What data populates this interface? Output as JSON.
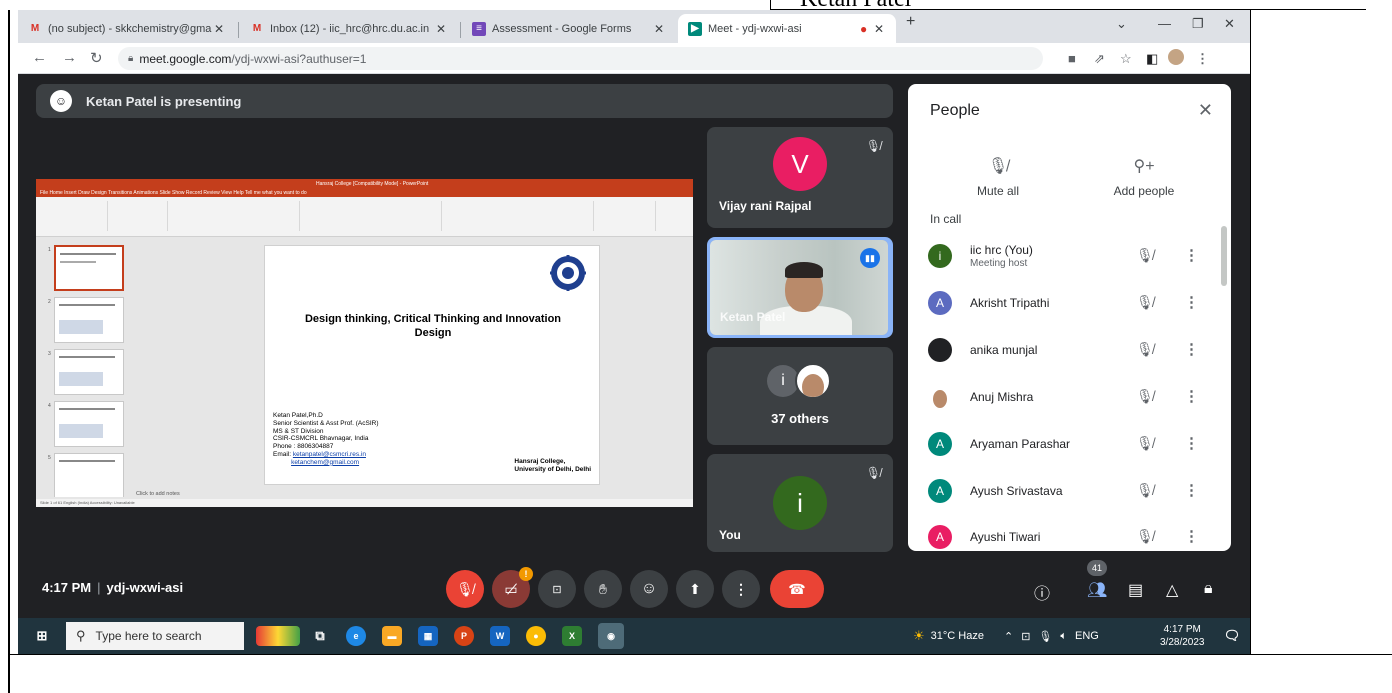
{
  "header": {
    "name_text": "Ketan Patel"
  },
  "browser": {
    "tabs": [
      {
        "label": "(no subject) - skkchemistry@gma",
        "icon": "gmail-icon"
      },
      {
        "label": "Inbox (12) - iic_hrc@hrc.du.ac.in",
        "icon": "gmail-icon"
      },
      {
        "label": "Assessment - Google Forms",
        "icon": "forms-icon"
      },
      {
        "label": "Meet - ydj-wxwi-asi",
        "icon": "meet-icon"
      }
    ],
    "url_host": "meet.google.com",
    "url_path": "/ydj-wxwi-asi?authuser=1"
  },
  "meet": {
    "presenting_text": "Ketan Patel is presenting",
    "slide": {
      "title_line1": "Design thinking, Critical Thinking and Innovation",
      "title_line2": "Design",
      "info_name": "Ketan Patel,Ph.D",
      "info_role": "Senior Scientist & Asst Prof. (AcSIR)",
      "info_div": "MS & ST Division",
      "info_org": "CSIR-CSMCRL Bhavnagar, India",
      "info_phone": "Phone : 8806304887",
      "info_email_label": "Email: ",
      "info_email1": "ketanpatel@csmcri.res.in",
      "info_email2": "ketanchem@gmail.com",
      "inst_line1": "Hansraj College,",
      "inst_line2": "University of Delhi, Delhi",
      "notes": "Click to add notes",
      "window_title": "Hansraj College [Compatibility Mode] - PowerPoint",
      "ribbon_tabs": "File   Home   Insert   Draw   Design   Transitions   Animations   Slide Show   Record   Review   View   Help   Tell me what you want to do",
      "status": "Slide 1 of 61    English (India)    Accessibility: Unavailable"
    },
    "tiles": [
      {
        "name": "Vijay rani Rajpal",
        "initial": "V",
        "color": "#e91e63"
      },
      {
        "name": "Ketan Patel"
      },
      {
        "label": "37 others",
        "initial": "i"
      },
      {
        "name": "You",
        "initial": "i",
        "color": "#33691e"
      }
    ],
    "people": {
      "title": "People",
      "mute_all": "Mute all",
      "add_people": "Add people",
      "in_call": "In call",
      "list": [
        {
          "name": "iic hrc (You)",
          "sub": "Meeting host",
          "initial": "i",
          "color": "#33691e"
        },
        {
          "name": "Akrisht Tripathi",
          "initial": "A",
          "color": "#5c6bc0"
        },
        {
          "name": "anika munjal",
          "initial": "",
          "color": "#202124"
        },
        {
          "name": "Anuj Mishra",
          "initial": "",
          "color": "#a1887f"
        },
        {
          "name": "Aryaman Parashar",
          "initial": "A",
          "color": "#00897b"
        },
        {
          "name": "Ayush Srivastava",
          "initial": "A",
          "color": "#00897b"
        },
        {
          "name": "Ayushi Tiwari",
          "initial": "A",
          "color": "#e91e63"
        }
      ]
    },
    "bottom": {
      "time": "4:17 PM",
      "code": "ydj-wxwi-asi",
      "participant_count": "41",
      "notice_badge": "!"
    }
  },
  "taskbar": {
    "search_placeholder": "Type here to search",
    "weather": "31°C  Haze",
    "lang": "ENG",
    "time": "4:17 PM",
    "date": "3/28/2023"
  }
}
